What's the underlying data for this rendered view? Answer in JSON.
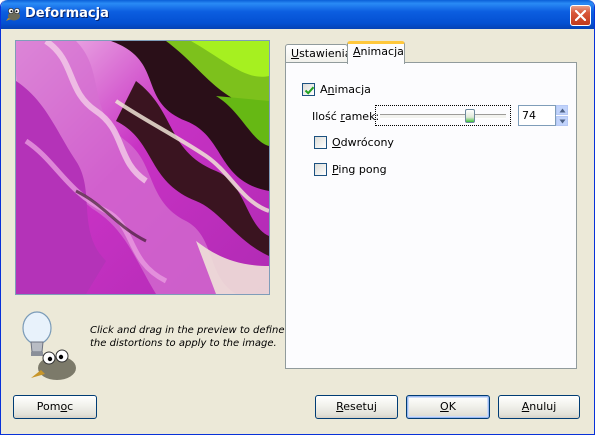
{
  "window": {
    "title": "Deformacja",
    "icon": "gimp-wilber-icon",
    "close_icon": "close-icon"
  },
  "preview": {
    "description_icon": "lightbulb-wilber-icon",
    "hint_line1": "Click and drag in the preview to define",
    "hint_line2": "the distortions to apply to the image."
  },
  "tabs": [
    {
      "label": "Ustawienia",
      "mnemonic": "U",
      "active": false
    },
    {
      "label": "Animacja",
      "mnemonic": "A",
      "active": true
    }
  ],
  "animation_tab": {
    "animate_checkbox": {
      "label": "Animacja",
      "mnemonic": "n",
      "checked": true
    },
    "frames": {
      "label": "Ilość ramek:",
      "mnemonic": "r",
      "value": "74",
      "slider_fraction": 0.74
    },
    "reverse_checkbox": {
      "label": "Odwrócony",
      "mnemonic": "O",
      "checked": false
    },
    "pingpong_checkbox": {
      "label": "Ping pong",
      "mnemonic": "P",
      "checked": false
    }
  },
  "buttons": {
    "help": "Pomoc",
    "reset": "Resetuj",
    "ok": "OK",
    "cancel": "Anuluj"
  },
  "colors": {
    "titlebar": "#0a5fd8",
    "dialog_bg": "#ece9d8",
    "tab_highlight": "#ffc83c",
    "close_button": "#c23a1c"
  }
}
